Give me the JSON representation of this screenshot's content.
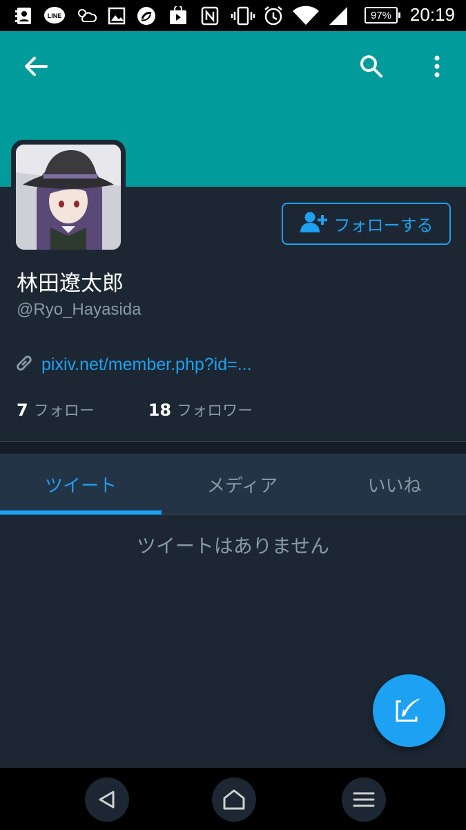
{
  "status_bar": {
    "battery": "97%",
    "time": "20:19",
    "icons": [
      "contacts-icon",
      "line-app-icon",
      "weather-icon",
      "gallery-icon",
      "sync-icon",
      "play-store-icon",
      "nfc-icon",
      "vibrate-icon",
      "alarm-icon",
      "wifi-icon",
      "signal-icon",
      "battery-icon"
    ]
  },
  "header": {
    "color": "#009b9a",
    "icons": [
      "back-arrow-icon",
      "search-icon",
      "more-vert-icon"
    ]
  },
  "profile": {
    "name": "林田遼太郎",
    "handle": "@Ryo_Hayasida",
    "follow_button": "フォローする",
    "link": "pixiv.net/member.php?id=...",
    "following_count": "7",
    "following_label": "フォロー",
    "followers_count": "18",
    "followers_label": "フォロワー"
  },
  "tabs": [
    {
      "label": "ツイート",
      "active": true
    },
    {
      "label": "メディア",
      "active": false
    },
    {
      "label": "いいね",
      "active": false
    }
  ],
  "empty_message": "ツイートはありません",
  "fab": {
    "icon": "compose-tweet-icon",
    "color": "#1da1f2"
  },
  "nav_bar": {
    "icons": [
      "nav-back-icon",
      "nav-home-icon",
      "nav-menu-icon"
    ]
  },
  "colors": {
    "accent": "#1da1f2",
    "background": "#1c2733",
    "muted": "#8899a6"
  }
}
